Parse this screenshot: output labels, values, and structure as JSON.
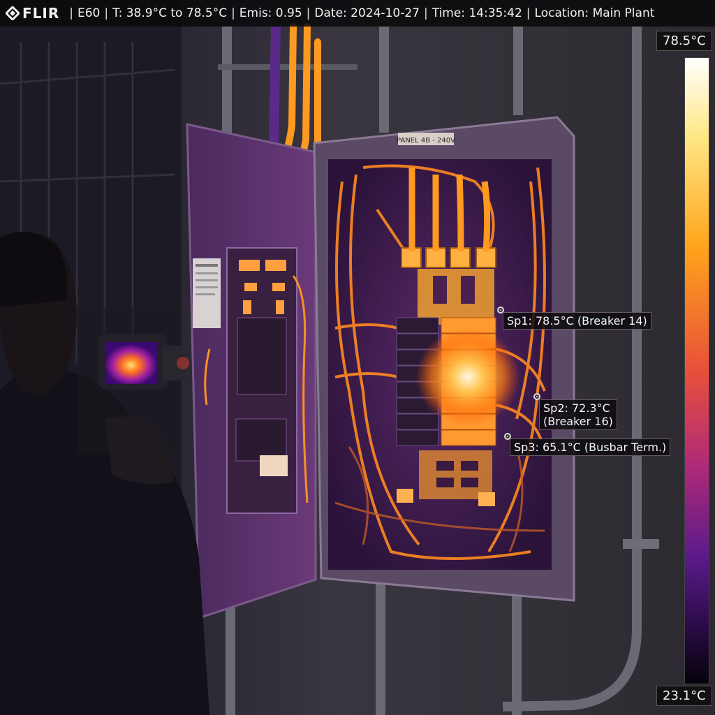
{
  "header": {
    "brand": "FLIR",
    "model": "E60",
    "range": "T: 38.9°C to 78.5°C",
    "emissivity": "Emis: 0.95",
    "date": "Date: 2024-10-27",
    "time": "Time: 14:35:42",
    "location": "Location: Main Plant"
  },
  "panel_label": "PANEL 4B - 240V",
  "scale": {
    "max": "78.5°C",
    "min": "23.1°C"
  },
  "spots": {
    "sp1": {
      "text": "Sp1: 78.5°C (Breaker 14)"
    },
    "sp2": {
      "line1": "Sp2: 72.3°C",
      "line2": "(Breaker 16)"
    },
    "sp3": {
      "text": "Sp3: 65.1°C (Busbar Term.)"
    }
  },
  "palette": {
    "hot": "#fff6d8",
    "warm": "#ffa21a",
    "mid": "#d6306a",
    "cool": "#5a1a8a",
    "cold": "#0a0612"
  },
  "icons": [
    "flir-logo-icon",
    "spot-marker-icon"
  ]
}
